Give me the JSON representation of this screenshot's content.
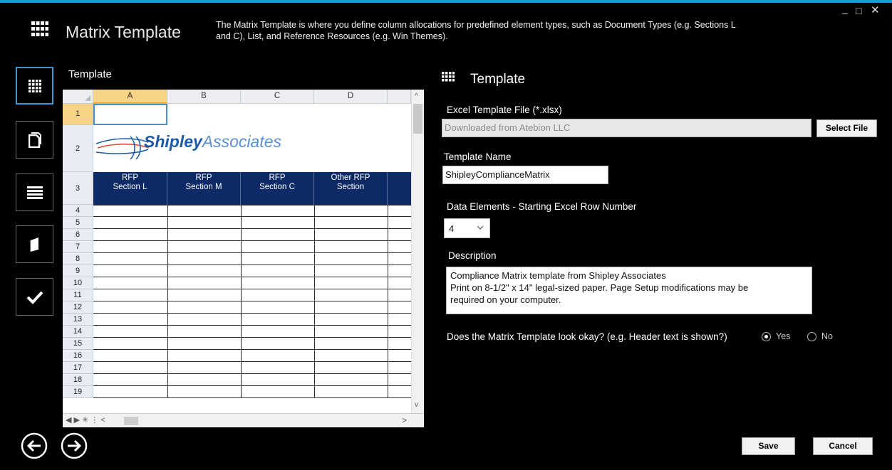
{
  "header": {
    "title": "Matrix Template",
    "description": "The Matrix Template is where you define column allocations for predefined element types, such as Document Types (e.g. Sections L and C), List, and Reference Resources (e.g. Win Themes).",
    "window_controls": {
      "minimize": "_",
      "maximize": "□",
      "close": "✕"
    }
  },
  "sidebar": {
    "items": [
      {
        "name": "matrix",
        "icon": "grid-icon",
        "active": true
      },
      {
        "name": "documents",
        "icon": "documents-icon",
        "active": false
      },
      {
        "name": "list",
        "icon": "list-icon",
        "active": false
      },
      {
        "name": "resources",
        "icon": "book-icon",
        "active": false
      },
      {
        "name": "review",
        "icon": "checkmark-icon",
        "active": false
      }
    ]
  },
  "preview": {
    "label": "Template",
    "columns": [
      "A",
      "B",
      "C",
      "D"
    ],
    "rows": [
      "1",
      "2",
      "3",
      "4",
      "5",
      "6",
      "7",
      "8",
      "9",
      "10",
      "11",
      "12",
      "13",
      "14",
      "15",
      "16",
      "17",
      "18",
      "19"
    ],
    "logo_text_bold": "Shipley",
    "logo_text_light": "Associates",
    "header_cells": [
      "RFP\nSection L",
      "RFP\nSection M",
      "RFP\nSection C",
      "Other RFP\nSection"
    ],
    "sheet_tab_controls": "◀ ▶  ✳ ⋮ <",
    "scroll_right": ">"
  },
  "form": {
    "title": "Template",
    "excel_label": "Excel Template File (*.xlsx)",
    "excel_value": "Downloaded from Atebion LLC",
    "select_file": "Select File",
    "name_label": "Template Name",
    "name_value": "ShipleyComplianceMatrix",
    "row_label": "Data Elements - Starting Excel Row Number",
    "row_value": "4",
    "desc_label": "Description",
    "desc_lines": [
      "Compliance Matrix template from Shipley Associates",
      "Print on 8-1/2\" x 14\" legal-sized paper. Page Setup modifications may be",
      "required on your computer."
    ],
    "question": "Does the Matrix Template look okay? (e.g. Header text is shown?)",
    "yes": "Yes",
    "no": "No",
    "selected": "Yes"
  },
  "footer": {
    "save": "Save",
    "cancel": "Cancel",
    "back_icon": "arrow-left-circle-icon",
    "next_icon": "arrow-right-circle-icon"
  }
}
